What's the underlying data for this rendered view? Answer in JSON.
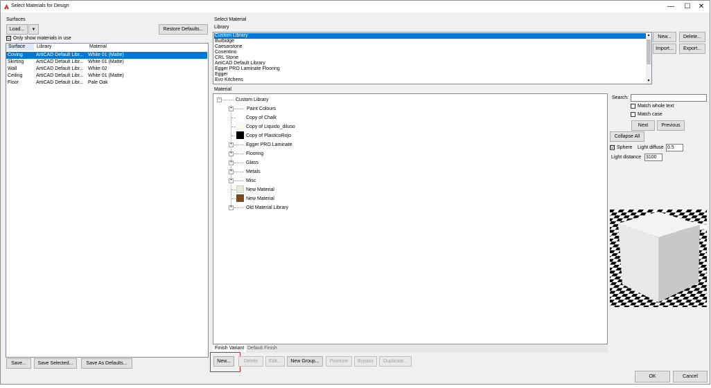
{
  "window": {
    "title": "Select Materials for Design",
    "minimize": "—",
    "maximize": "☐",
    "close": "✕"
  },
  "surfaces": {
    "group_label": "Surfaces",
    "load_button": "Load...",
    "load_dropdown": "▼",
    "restore_defaults": "Restore Defaults...",
    "only_show_in_use": "Only show materials in use",
    "only_show_checked": "☑",
    "columns": [
      "Surface",
      "Library",
      "Material"
    ],
    "rows": [
      {
        "surface": "Coving",
        "library": "ArtiCAD Default Libr...",
        "material": "White 01 (Matte)"
      },
      {
        "surface": "Skirting",
        "library": "ArtiCAD Default Libr...",
        "material": "White 01 (Matte)"
      },
      {
        "surface": "Wall",
        "library": "ArtiCAD Default Libr...",
        "material": "White 02"
      },
      {
        "surface": "Ceiling",
        "library": "ArtiCAD Default Libr...",
        "material": "White 01 (Matte)"
      },
      {
        "surface": "Floor",
        "library": "ArtiCAD Default Libr...",
        "material": "Pale Oak"
      }
    ],
    "save": "Save...",
    "save_selected": "Save Selected...",
    "save_as_defaults": "Save As Defaults..."
  },
  "select_material": {
    "group_label": "Select Material",
    "library_label": "Library",
    "libraries": [
      "Custom Library",
      "Burbidge",
      "Caesarstone",
      "Cosentino",
      "CRL Stone",
      "ArtiCAD Default Library",
      "Egger PRO Laminate Flooring",
      "Egger",
      "Evo Kitchens"
    ],
    "lib_new": "New...",
    "lib_delete": "Delete...",
    "lib_import": "Import...",
    "lib_export": "Export..."
  },
  "material": {
    "label": "Material",
    "tree": {
      "root": "Custom Library",
      "items": [
        {
          "label": "Paint Colours",
          "expandable": true
        },
        {
          "label": "Copy of Chalk",
          "expandable": false,
          "swatch": "#ffffff"
        },
        {
          "label": "Copy of Liquido_diluso",
          "expandable": false,
          "swatch": "#fafaf0"
        },
        {
          "label": "Copy of PlasticoRojo",
          "expandable": false,
          "swatch": "#000000"
        },
        {
          "label": "Egger PRO Laminate",
          "expandable": true
        },
        {
          "label": "Flooring",
          "expandable": true
        },
        {
          "label": "Glass",
          "expandable": true
        },
        {
          "label": "Metals",
          "expandable": true
        },
        {
          "label": "Misc",
          "expandable": true
        },
        {
          "label": "New Material",
          "expandable": false,
          "swatch": "#e6e8d8"
        },
        {
          "label": "New Material",
          "expandable": false,
          "swatch": "#7a4a1a"
        },
        {
          "label": "Old Material Library",
          "expandable": true
        }
      ]
    }
  },
  "search": {
    "label": "Search:",
    "value": "",
    "match_whole_text": "Match whole text",
    "match_case": "Match case",
    "next": "Next",
    "previous": "Previous",
    "collapse_all": "Collapse All",
    "sphere": "Sphere",
    "sphere_checked": "☑",
    "light_diffuse_label": "Light diffuse",
    "light_diffuse_value": "0.5",
    "light_distance_label": "Light distance",
    "light_distance_value": "3100"
  },
  "tabs": {
    "finish_variant": "Finish Variant",
    "default_finish": "Default Finish"
  },
  "bottom_toolbar": {
    "new": "New...",
    "delete": "Delete",
    "edit": "Edit...",
    "new_group": "New Group...",
    "promote": "Promote",
    "bypass": "Bypass",
    "duplicate": "Duplicate..."
  },
  "dialog": {
    "ok": "OK",
    "cancel": "Cancel"
  },
  "colors": {
    "selection": "#0078d7",
    "highlight_box": "#e02020",
    "app_icon": "#c0392b"
  }
}
